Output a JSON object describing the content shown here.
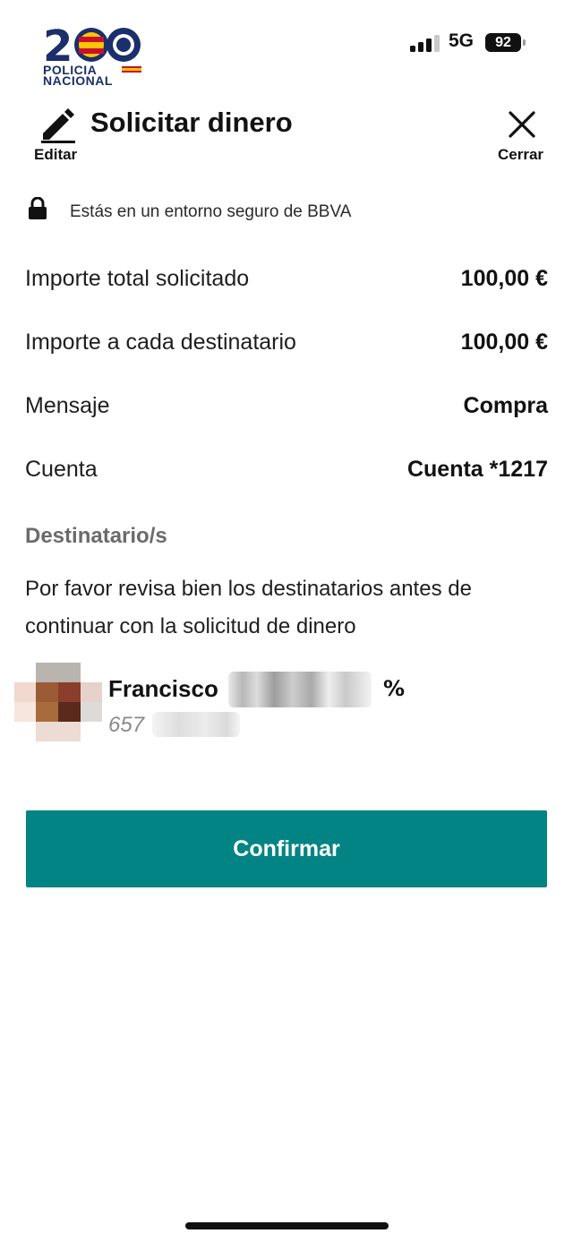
{
  "status_bar": {
    "network": "5G",
    "battery": "92"
  },
  "logo": {
    "number": "200",
    "text_line1": "POLICIA",
    "text_line2": "NACIONAL"
  },
  "header": {
    "title": "Solicitar dinero",
    "edit_label": "Editar",
    "close_label": "Cerrar"
  },
  "secure_note": "Estás en un entorno seguro de BBVA",
  "details": [
    {
      "label": "Importe total solicitado",
      "value": "100,00 €"
    },
    {
      "label": "Importe a cada destinatario",
      "value": "100,00 €"
    },
    {
      "label": "Mensaje",
      "value": "Compra"
    },
    {
      "label": "Cuenta",
      "value": "Cuenta *1217"
    }
  ],
  "recipients_section": {
    "title": "Destinatario/s",
    "notice": "Por favor revisa bien los destinatarios antes de continuar con la solicitud de dinero",
    "recipient": {
      "name": "Francisco",
      "phone_prefix": "657",
      "icon": "bizum-icon",
      "icon_glyph": "%"
    }
  },
  "confirm_button": "Confirmar",
  "colors": {
    "accent": "#028484",
    "text": "#121212",
    "muted": "#6b6b6b"
  }
}
